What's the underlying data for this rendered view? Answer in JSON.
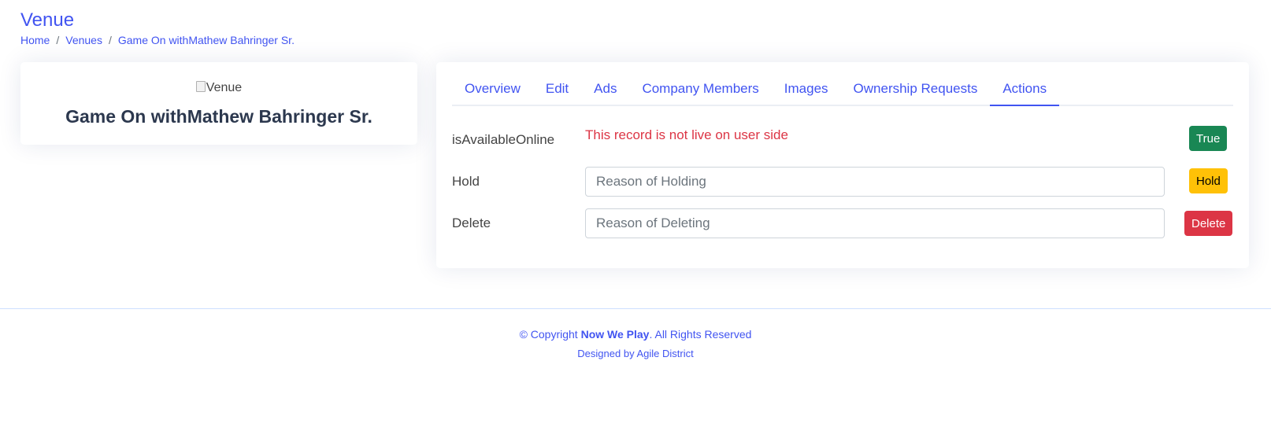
{
  "header": {
    "title": "Venue",
    "breadcrumb": [
      "Home",
      "Venues",
      "Game On withMathew Bahringer Sr."
    ],
    "separator": "/"
  },
  "profile": {
    "image_alt": "Venue",
    "name": "Game On withMathew Bahringer Sr."
  },
  "tabs": [
    {
      "label": "Overview",
      "active": false
    },
    {
      "label": "Edit",
      "active": false
    },
    {
      "label": "Ads",
      "active": false
    },
    {
      "label": "Company Members",
      "active": false
    },
    {
      "label": "Images",
      "active": false
    },
    {
      "label": "Ownership Requests",
      "active": false
    },
    {
      "label": "Actions",
      "active": true
    }
  ],
  "actions": {
    "available": {
      "label": "isAvailableOnline",
      "status": "This record is not live on user side",
      "button": "True"
    },
    "hold": {
      "label": "Hold",
      "placeholder": "Reason of Holding",
      "button": "Hold"
    },
    "delete": {
      "label": "Delete",
      "placeholder": "Reason of Deleting",
      "button": "Delete"
    }
  },
  "footer": {
    "copyright_prefix": "© Copyright ",
    "brand": "Now We Play",
    "copyright_suffix": ". All Rights Reserved",
    "credits": "Designed by Agile District"
  },
  "colors": {
    "primary": "#4154f1",
    "success": "#198754",
    "warning": "#ffc107",
    "danger": "#dc3545"
  }
}
